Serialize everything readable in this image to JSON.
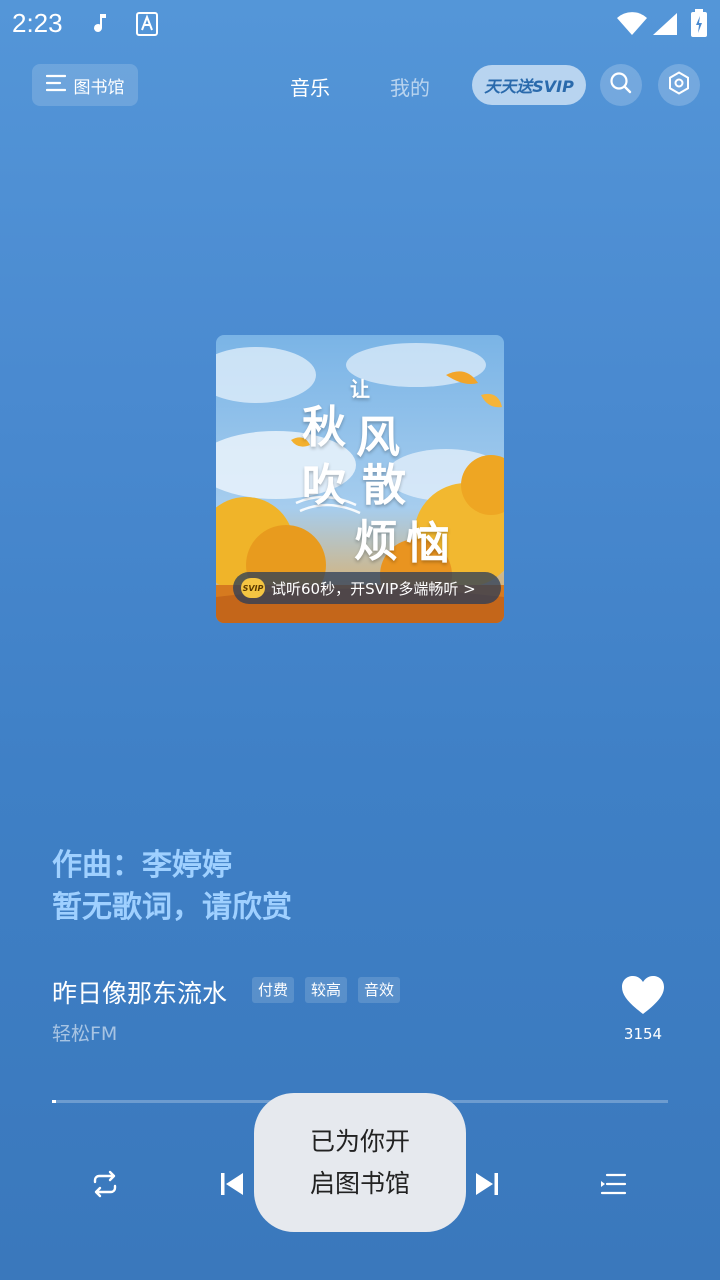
{
  "status_bar": {
    "time": "2:23"
  },
  "header": {
    "library_label": "图书馆",
    "tabs": [
      {
        "label": "音乐",
        "active": true
      },
      {
        "label": "我的",
        "active": false
      }
    ],
    "svip_label": "天天送SVIP"
  },
  "cover": {
    "title_chars": [
      "让",
      "秋",
      "风",
      "吹",
      "散",
      "烦",
      "恼"
    ],
    "badge_label": "SVIP",
    "trial_text": "试听60秒，开SVIP多端畅听 >"
  },
  "lyrics": {
    "line1": "作曲：李婷婷",
    "line2": "暂无歌词，请欣赏"
  },
  "song": {
    "title": "昨日像那东流水",
    "tags": [
      "付费",
      "较高",
      "音效"
    ],
    "artist": "轻松FM",
    "like_count": "3154"
  },
  "progress": {
    "fraction": 0.005
  },
  "toast": {
    "line1": "已为你开",
    "line2": "启图书馆"
  },
  "colors": {
    "background_top": "#5496d8",
    "background_bottom": "#3a78bc",
    "lyric": "#9fd0ff",
    "svip_pill": "#b8d4f0"
  }
}
